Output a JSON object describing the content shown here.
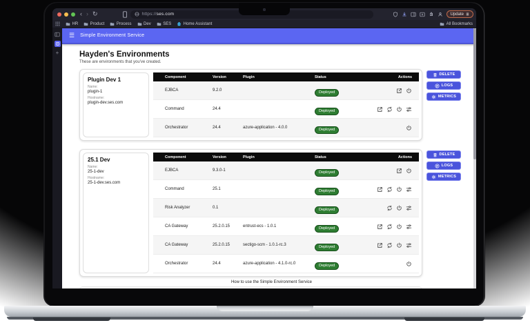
{
  "browser": {
    "url_scheme": "https://",
    "url_host": "ses.com",
    "update_button": "Update",
    "bookmarks_bar": {
      "folders": [
        "HR",
        "Product",
        "Process",
        "Dev",
        "SES"
      ],
      "home_assistant": "Home Assistant",
      "all_bookmarks": "All Bookmarks"
    }
  },
  "app": {
    "header_title": "Simple Environment Service",
    "page_title": "Hayden's Environments",
    "page_subtitle": "These are environments that you've created.",
    "footer_link": "How to use the Simple Environment Service",
    "table_headers": [
      "Component",
      "Version",
      "Plugin",
      "Status",
      "Actions"
    ],
    "env_buttons": [
      "DELETE",
      "LOGS",
      "METRICS"
    ],
    "labels": {
      "name": "Name:",
      "hostname": "Hostname:"
    },
    "environments": [
      {
        "title": "Plugin Dev 1",
        "name": "plugin-1",
        "hostname": "plugin-dev.ses.com",
        "rows": [
          {
            "component": "EJBCA",
            "version": "9.2.0",
            "plugin": "",
            "status": "Deployed",
            "actions": [
              "open-in-new",
              "power"
            ]
          },
          {
            "component": "Command",
            "version": "24.4",
            "plugin": "",
            "status": "Deployed",
            "actions": [
              "open-in-new",
              "refresh",
              "power",
              "tune"
            ]
          },
          {
            "component": "Orchestrator",
            "version": "24.4",
            "plugin": "azure-application - 4.0.0",
            "status": "Deployed",
            "actions": [
              "power"
            ]
          }
        ]
      },
      {
        "title": "25.1 Dev",
        "name": "25-1-dev",
        "hostname": "25-1-dev.ses.com",
        "rows": [
          {
            "component": "EJBCA",
            "version": "9.3.0-1",
            "plugin": "",
            "status": "Deployed",
            "actions": [
              "open-in-new",
              "power"
            ]
          },
          {
            "component": "Command",
            "version": "25.1",
            "plugin": "",
            "status": "Deployed",
            "actions": [
              "open-in-new",
              "refresh",
              "power",
              "tune"
            ]
          },
          {
            "component": "Risk Analyzer",
            "version": "0.1",
            "plugin": "",
            "status": "Deployed",
            "actions": [
              "refresh",
              "power",
              "tune"
            ]
          },
          {
            "component": "CA Gateway",
            "version": "25.2.0.15",
            "plugin": "entrust-ecs - 1.0.1",
            "status": "Deployed",
            "actions": [
              "open-in-new",
              "refresh",
              "power",
              "tune"
            ]
          },
          {
            "component": "CA Gateway",
            "version": "25.2.0.15",
            "plugin": "sectigo-scm - 1.0.1-rc.3",
            "status": "Deployed",
            "actions": [
              "open-in-new",
              "refresh",
              "power",
              "tune"
            ]
          },
          {
            "component": "Orchestrator",
            "version": "24.4",
            "plugin": "azure-application - 4.1.0-rc.0",
            "status": "Deployed",
            "actions": [
              "power"
            ]
          }
        ]
      }
    ]
  },
  "colors": {
    "app_accent": "#5b66f2",
    "env_button": "#4a54dc",
    "status_deployed": "#2e7d32",
    "update_border": "#c06a4a",
    "toolbar_bg": "#23232e"
  }
}
